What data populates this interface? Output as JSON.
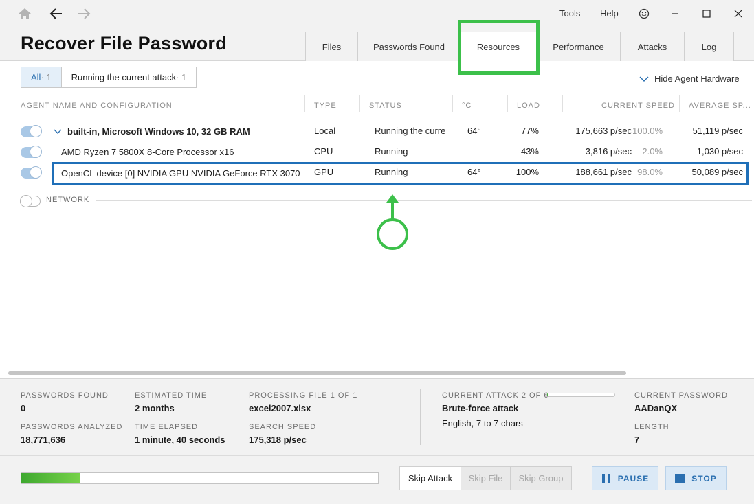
{
  "menu": {
    "tools": "Tools",
    "help": "Help"
  },
  "page_title": "Recover File Password",
  "tabs": [
    {
      "label": "Files"
    },
    {
      "label": "Passwords Found"
    },
    {
      "label": "Resources"
    },
    {
      "label": "Performance"
    },
    {
      "label": "Attacks"
    },
    {
      "label": "Log"
    }
  ],
  "filters": {
    "all_label": "All",
    "all_count": " · 1",
    "running_label": "Running the current attack",
    "running_count": " · 1"
  },
  "hide_hardware": "Hide Agent Hardware",
  "columns": {
    "name": "AGENT NAME AND CONFIGURATION",
    "type": "TYPE",
    "status": "STATUS",
    "temp": "°C",
    "load": "LOAD",
    "current_speed": "CURRENT SPEED",
    "average_speed": "AVERAGE SP..."
  },
  "rows": [
    {
      "name": "built-in, Microsoft Windows 10, 32 GB RAM",
      "type": "Local",
      "status": "Running the curre",
      "temp": "64°",
      "load": "77%",
      "speed": "175,663 p/sec",
      "share": "100.0%",
      "avg": "51,119 p/sec"
    },
    {
      "name": "AMD Ryzen 7 5800X 8-Core Processor x16",
      "type": "CPU",
      "status": "Running",
      "temp": "—",
      "load": "43%",
      "speed": "3,816 p/sec",
      "share": "2.0%",
      "avg": "1,030 p/sec"
    },
    {
      "name": "OpenCL device [0] NVIDIA GPU NVIDIA GeForce RTX 3070",
      "type": "GPU",
      "status": "Running",
      "temp": "64°",
      "load": "100%",
      "speed": "188,661 p/sec",
      "share": "98.0%",
      "avg": "50,089 p/sec"
    }
  ],
  "network_label": "NETWORK",
  "stats": {
    "passwords_found_label": "PASSWORDS FOUND",
    "passwords_found": "0",
    "passwords_analyzed_label": "PASSWORDS ANALYZED",
    "passwords_analyzed": "18,771,636",
    "estimated_time_label": "ESTIMATED TIME",
    "estimated_time": "2 months",
    "time_elapsed_label": "TIME ELAPSED",
    "time_elapsed": "1 minute, 40 seconds",
    "processing_file_label": "PROCESSING FILE 1 OF 1",
    "processing_file": "excel2007.xlsx",
    "search_speed_label": "SEARCH SPEED",
    "search_speed": "175,318 p/sec",
    "current_attack_label": "CURRENT ATTACK 2 OF 6",
    "current_attack_progress": 0.02,
    "current_attack": "Brute-force attack",
    "attack_detail": "English, 7 to 7 chars",
    "current_password_label": "CURRENT PASSWORD",
    "current_password": "AADanQX",
    "length_label": "LENGTH",
    "length": "7"
  },
  "overall_progress": 0.165,
  "buttons": {
    "skip_attack": "Skip Attack",
    "skip_file": "Skip File",
    "skip_group": "Skip Group",
    "pause": "PAUSE",
    "stop": "STOP"
  },
  "colors": {
    "accent": "#2a6fb0",
    "annotation": "#3cc04a",
    "selection": "#1f6fb8",
    "progress": "#49b03c"
  }
}
